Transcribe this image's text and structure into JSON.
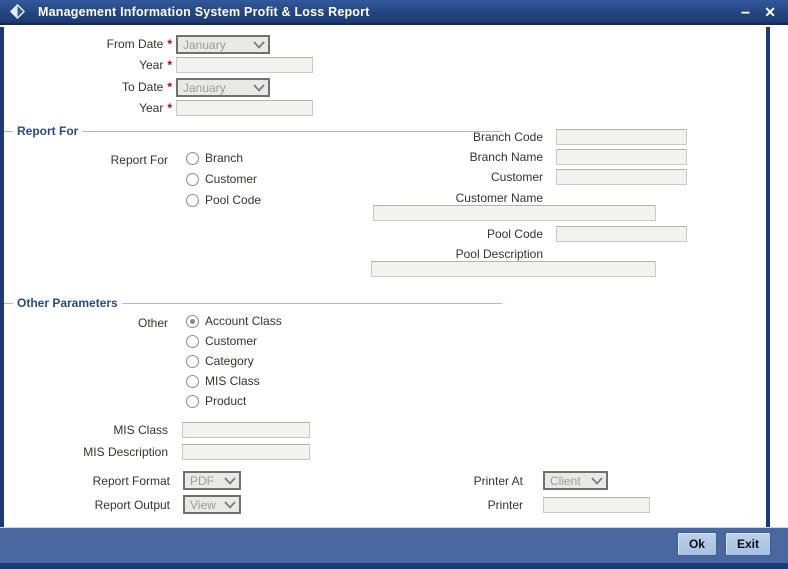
{
  "window": {
    "title": "Management Information System Profit & Loss Report",
    "minimize_glyph": "−",
    "close_glyph": "✕"
  },
  "date_form": {
    "required_marker": "*",
    "from_date": {
      "label": "From Date",
      "value": "January"
    },
    "from_year": {
      "label": "Year",
      "value": ""
    },
    "to_date": {
      "label": "To Date",
      "value": "January"
    },
    "to_year": {
      "label": "Year",
      "value": ""
    }
  },
  "report_for": {
    "title": "Report For",
    "group_label": "Report For",
    "options": [
      {
        "label": "Branch",
        "selected": false
      },
      {
        "label": "Customer",
        "selected": false
      },
      {
        "label": "Pool Code",
        "selected": false
      }
    ],
    "fields": {
      "branch_code": {
        "label": "Branch Code",
        "value": ""
      },
      "branch_name": {
        "label": "Branch Name",
        "value": ""
      },
      "customer": {
        "label": "Customer",
        "value": ""
      },
      "customer_name": {
        "label": "Customer Name",
        "value": ""
      },
      "pool_code": {
        "label": "Pool Code",
        "value": ""
      },
      "pool_description": {
        "label": "Pool Description",
        "value": ""
      }
    }
  },
  "other_parameters": {
    "title": "Other Parameters",
    "group_label": "Other",
    "options": [
      {
        "label": "Account Class",
        "selected": true
      },
      {
        "label": "Customer",
        "selected": false
      },
      {
        "label": "Category",
        "selected": false
      },
      {
        "label": "MIS Class",
        "selected": false
      },
      {
        "label": "Product",
        "selected": false
      }
    ],
    "fields": {
      "mis_class": {
        "label": "MIS Class",
        "value": ""
      },
      "mis_description": {
        "label": "MIS Description",
        "value": ""
      }
    }
  },
  "output_options": {
    "report_format": {
      "label": "Report Format",
      "value": "PDF"
    },
    "report_output": {
      "label": "Report Output",
      "value": "View"
    },
    "printer_at": {
      "label": "Printer At",
      "value": "Client"
    },
    "printer": {
      "label": "Printer",
      "value": ""
    }
  },
  "footer": {
    "ok": "Ok",
    "exit": "Exit"
  },
  "colors": {
    "titlebar": "#1d3b74",
    "footer_band": "#4a67a0",
    "section_title": "#2c4b7c",
    "required": "#c00000",
    "button": "#a9c4e4"
  }
}
